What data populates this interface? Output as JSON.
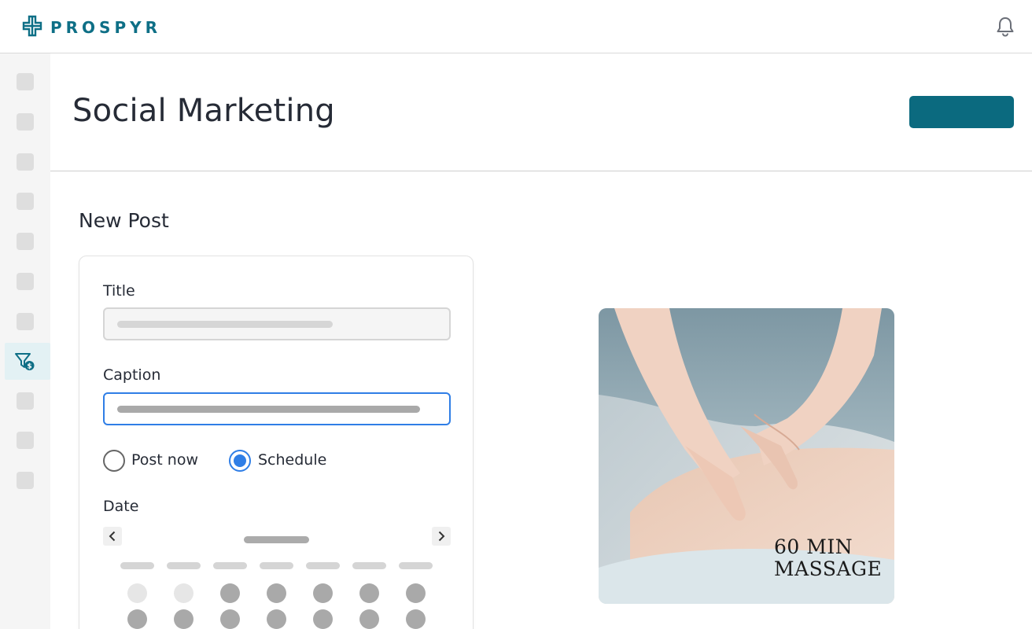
{
  "app": {
    "brand_name": "PROSPYR",
    "brand_color": "#0e6f86",
    "accent_color": "#2f7ee6",
    "icons": [
      "logo-cross-icon",
      "bell-icon",
      "funnel-dollar-icon",
      "chevron-left-icon",
      "chevron-right-icon"
    ]
  },
  "header": {
    "title": "Social Marketing"
  },
  "form": {
    "section_title": "New Post",
    "title_label": "Title",
    "caption_label": "Caption",
    "post_now_label": "Post now",
    "schedule_label": "Schedule",
    "selected_option": "Schedule",
    "date_label": "Date"
  },
  "preview": {
    "caption_line1": "60 MIN",
    "caption_line2": "MASSAGE"
  }
}
